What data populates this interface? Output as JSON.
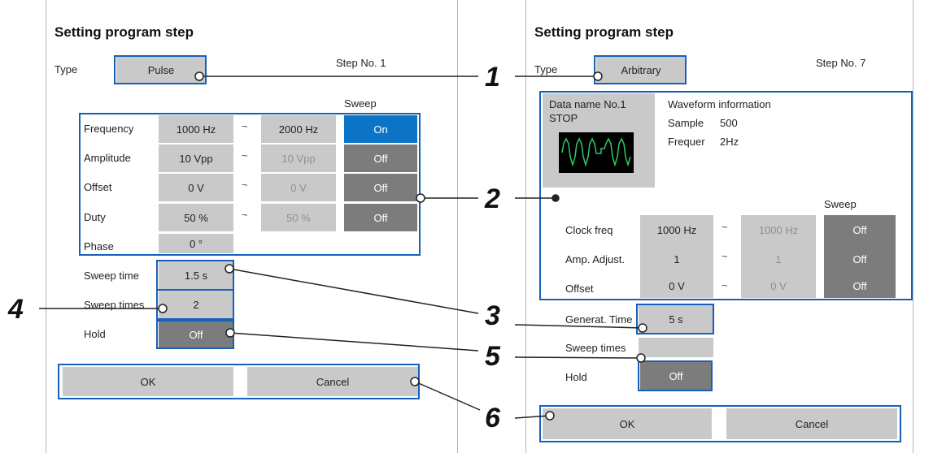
{
  "left": {
    "title": "Setting program step",
    "type_label": "Type",
    "type_value": "Pulse",
    "step_no": "Step No. 1",
    "sweep_header": "Sweep",
    "rows": [
      {
        "label": "Frequency",
        "start": "1000 Hz",
        "tilde": "~",
        "end": "2000 Hz",
        "sweep": "On"
      },
      {
        "label": "Amplitude",
        "start": "10 Vpp",
        "tilde": "~",
        "end": "10 Vpp",
        "sweep": "Off"
      },
      {
        "label": "Offset",
        "start": "0 V",
        "tilde": "~",
        "end": "0 V",
        "sweep": "Off"
      },
      {
        "label": "Duty",
        "start": "50 %",
        "tilde": "~",
        "end": "50 %",
        "sweep": "Off"
      },
      {
        "label": "Phase",
        "start": "0 °"
      }
    ],
    "sweep_time_label": "Sweep time",
    "sweep_time_value": "1.5 s",
    "sweep_times_label": "Sweep times",
    "sweep_times_value": "2",
    "hold_label": "Hold",
    "hold_value": "Off",
    "ok_label": "OK",
    "cancel_label": "Cancel"
  },
  "right": {
    "title": "Setting program step",
    "type_label": "Type",
    "type_value": "Arbitrary",
    "step_no": "Step No. 7",
    "data_name": "Data name  No.1",
    "data_state": "STOP",
    "waveform_info_label": "Waveform information",
    "sample_label": "Sample",
    "sample_value": "500",
    "freq_label": "Frequer",
    "freq_value": "2Hz",
    "sweep_header": "Sweep",
    "rows": [
      {
        "label": "Clock freq",
        "start": "1000 Hz",
        "tilde": "~",
        "end": "1000 Hz",
        "sweep": "Off"
      },
      {
        "label": "Amp. Adjust.",
        "start": "1",
        "tilde": "~",
        "end": "1",
        "sweep": "Off"
      },
      {
        "label": "Offset",
        "start": "0 V",
        "tilde": "~",
        "end": "0 V",
        "sweep": "Off"
      }
    ],
    "gen_time_label": "Generat. Time",
    "gen_time_value": "5 s",
    "sweep_times_label": "Sweep times",
    "hold_label": "Hold",
    "hold_value": "Off",
    "ok_label": "OK",
    "cancel_label": "Cancel"
  },
  "callouts": [
    "1",
    "2",
    "3",
    "4",
    "5",
    "6"
  ],
  "colors": {
    "highlight": "#1760b8",
    "on": "#0b74c6",
    "off": "#7c7c7c",
    "cell": "#c9c9c9"
  }
}
